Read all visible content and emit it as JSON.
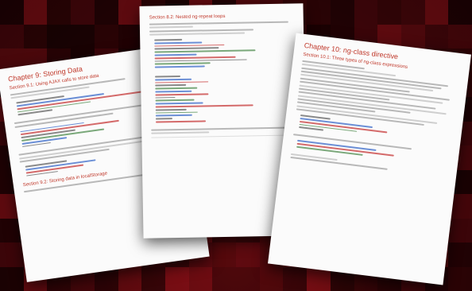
{
  "background": {
    "base_color": "#3a0508",
    "accent_color": "#7a0f14"
  },
  "pages": [
    {
      "chapter_title": "Chapter 9: Storing Data",
      "section_title": "Section 9.1: Using AJAX calls to store data",
      "section_title_2": "Section 9.2: Storing data in localStorage",
      "heading_color": "#c0392b"
    },
    {
      "section_title": "Section 8.2: Nested ng-repeat loops",
      "heading_color": "#c0392b"
    },
    {
      "chapter_title": "Chapter 10: ng-class directive",
      "section_title": "Section 10.1: Three types of ng-class expressions",
      "heading_color": "#c0392b"
    }
  ]
}
